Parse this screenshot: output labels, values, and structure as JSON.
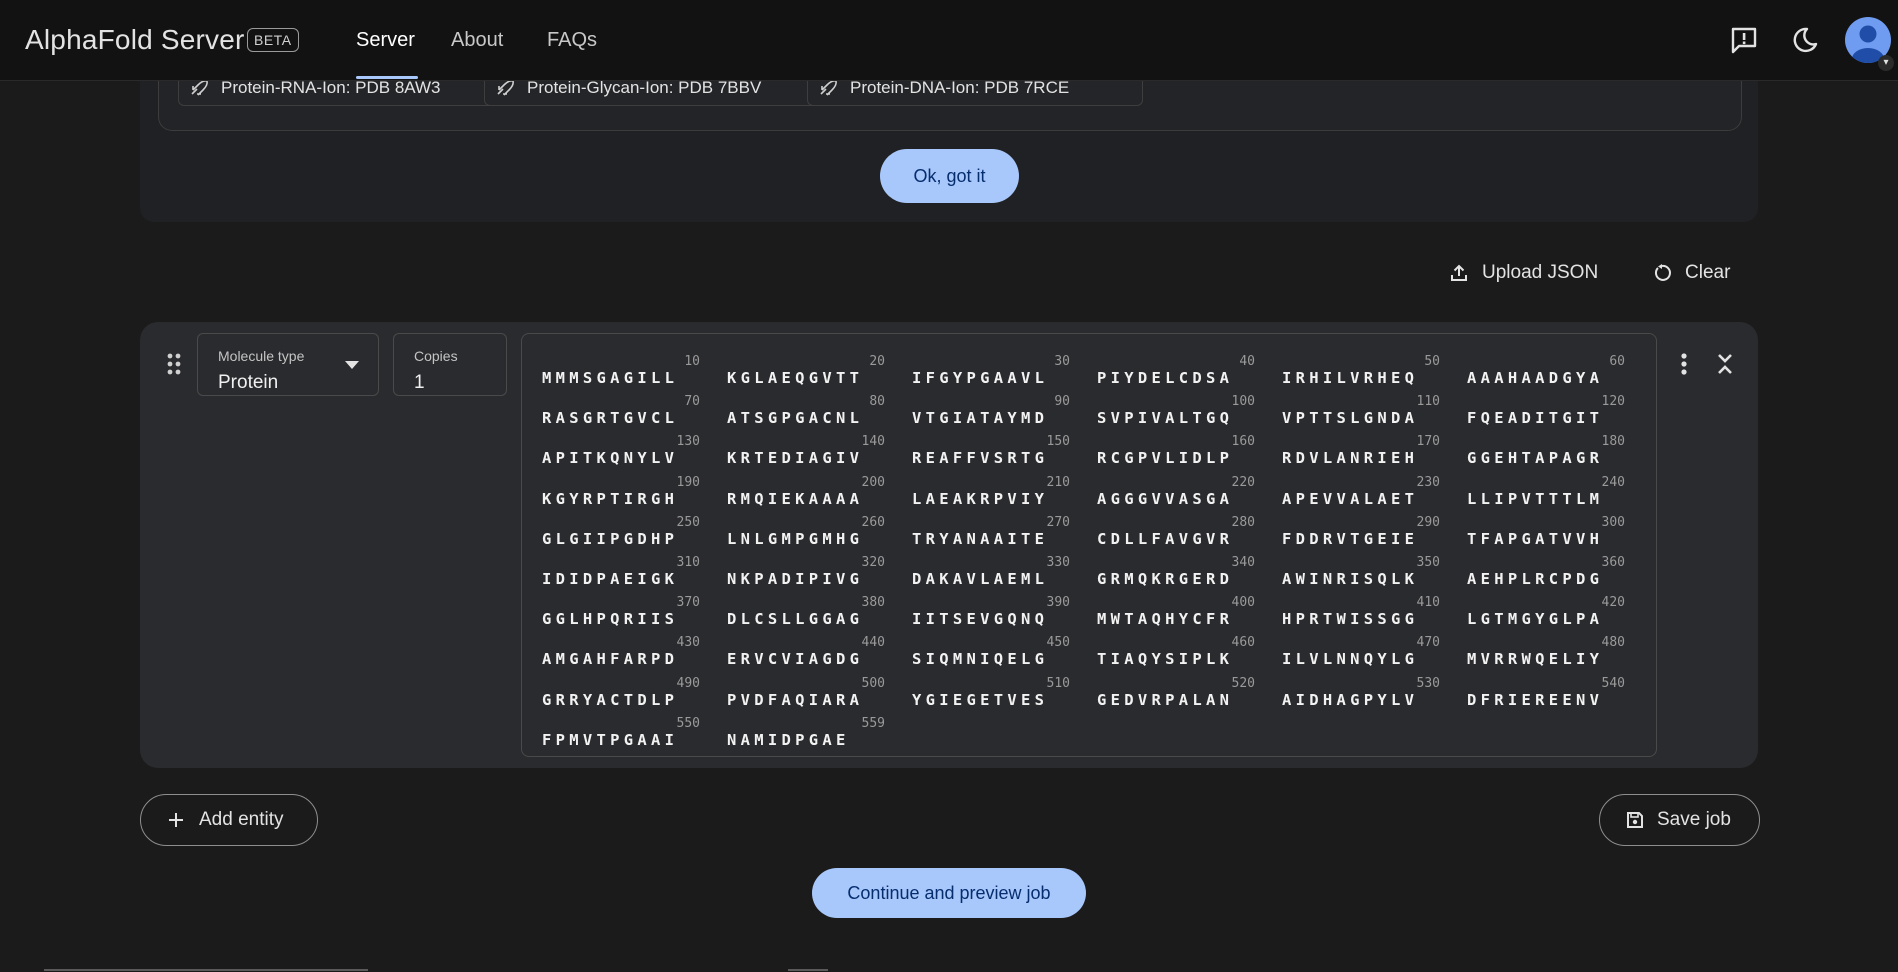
{
  "header": {
    "brand": "AlphaFold Server",
    "badge": "BETA",
    "nav": [
      {
        "label": "Server",
        "active": true
      },
      {
        "label": "About",
        "active": false
      },
      {
        "label": "FAQs",
        "active": false
      }
    ],
    "icons": [
      "feedback-icon",
      "dark-mode-moon-icon",
      "account-avatar"
    ]
  },
  "examples": {
    "chips": [
      "Protein-RNA-Ion: PDB 8AW3",
      "Protein-Glycan-Ion: PDB 7BBV",
      "Protein-DNA-Ion: PDB 7RCE"
    ],
    "ok_label": "Ok, got it"
  },
  "toolbar": {
    "upload_label": "Upload JSON",
    "clear_label": "Clear"
  },
  "entity": {
    "molecule_type_label": "Molecule type",
    "molecule_type_value": "Protein",
    "copies_label": "Copies",
    "copies_value": "1",
    "sequence_rows": [
      {
        "nums": [
          "10",
          "20",
          "30",
          "40",
          "50",
          "60"
        ],
        "groups": [
          "MMMSGAGILL",
          "KGLAEQGVTT",
          "IFGYPGAAVL",
          "PIYDELCDSA",
          "IRHILVRHEQ",
          "AAAHAADGYA"
        ]
      },
      {
        "nums": [
          "70",
          "80",
          "90",
          "100",
          "110",
          "120"
        ],
        "groups": [
          "RASGRTGVCL",
          "ATSGPGACNL",
          "VTGIATAYMD",
          "SVPIVALTGQ",
          "VPTTSLGNDA",
          "FQEADITGIT"
        ]
      },
      {
        "nums": [
          "130",
          "140",
          "150",
          "160",
          "170",
          "180"
        ],
        "groups": [
          "APITKQNYLV",
          "KRTEDIAGIV",
          "REAFFVSRTG",
          "RCGPVLIDLP",
          "RDVLANRIEH",
          "GGEHTAPAGR"
        ]
      },
      {
        "nums": [
          "190",
          "200",
          "210",
          "220",
          "230",
          "240"
        ],
        "groups": [
          "KGYRPTIRGH",
          "RMQIEKAAAA",
          "LAEAKRPVIY",
          "AGGGVVASGA",
          "APEVVALAET",
          "LLIPVTTTLM"
        ]
      },
      {
        "nums": [
          "250",
          "260",
          "270",
          "280",
          "290",
          "300"
        ],
        "groups": [
          "GLGIIPGDHP",
          "LNLGMPGMHG",
          "TRYANAAITE",
          "CDLLFAVGVR",
          "FDDRVTGEIE",
          "TFAPGATVVH"
        ]
      },
      {
        "nums": [
          "310",
          "320",
          "330",
          "340",
          "350",
          "360"
        ],
        "groups": [
          "IDIDPAEIGK",
          "NKPADIPIVG",
          "DAKAVLAEML",
          "GRMQKRGERD",
          "AWINRISQLK",
          "AEHPLRCPDG"
        ]
      },
      {
        "nums": [
          "370",
          "380",
          "390",
          "400",
          "410",
          "420"
        ],
        "groups": [
          "GGLHPQRIIS",
          "DLCSLLGGAG",
          "IITSEVGQNQ",
          "MWTAQHYCFR",
          "HPRTWISSGG",
          "LGTMGYGLPA"
        ]
      },
      {
        "nums": [
          "430",
          "440",
          "450",
          "460",
          "470",
          "480"
        ],
        "groups": [
          "AMGAHFARPD",
          "ERVCVIAGDG",
          "SIQMNIQELG",
          "TIAQYSIPLK",
          "ILVLNNQYLG",
          "MVRRWQELIY"
        ]
      },
      {
        "nums": [
          "490",
          "500",
          "510",
          "520",
          "530",
          "540"
        ],
        "groups": [
          "GRRYACTDLP",
          "PVDFAQIARA",
          "YGIEGETVES",
          "GEDVRPALAN",
          "AIDHAGPYLV",
          "DFRIEREENV"
        ]
      },
      {
        "nums": [
          "550",
          "559"
        ],
        "groups": [
          "FPMVTPGAAI",
          "NAMIDPGAE"
        ]
      }
    ]
  },
  "actions": {
    "add_entity_label": "Add entity",
    "save_job_label": "Save job",
    "continue_label": "Continue and preview job"
  }
}
